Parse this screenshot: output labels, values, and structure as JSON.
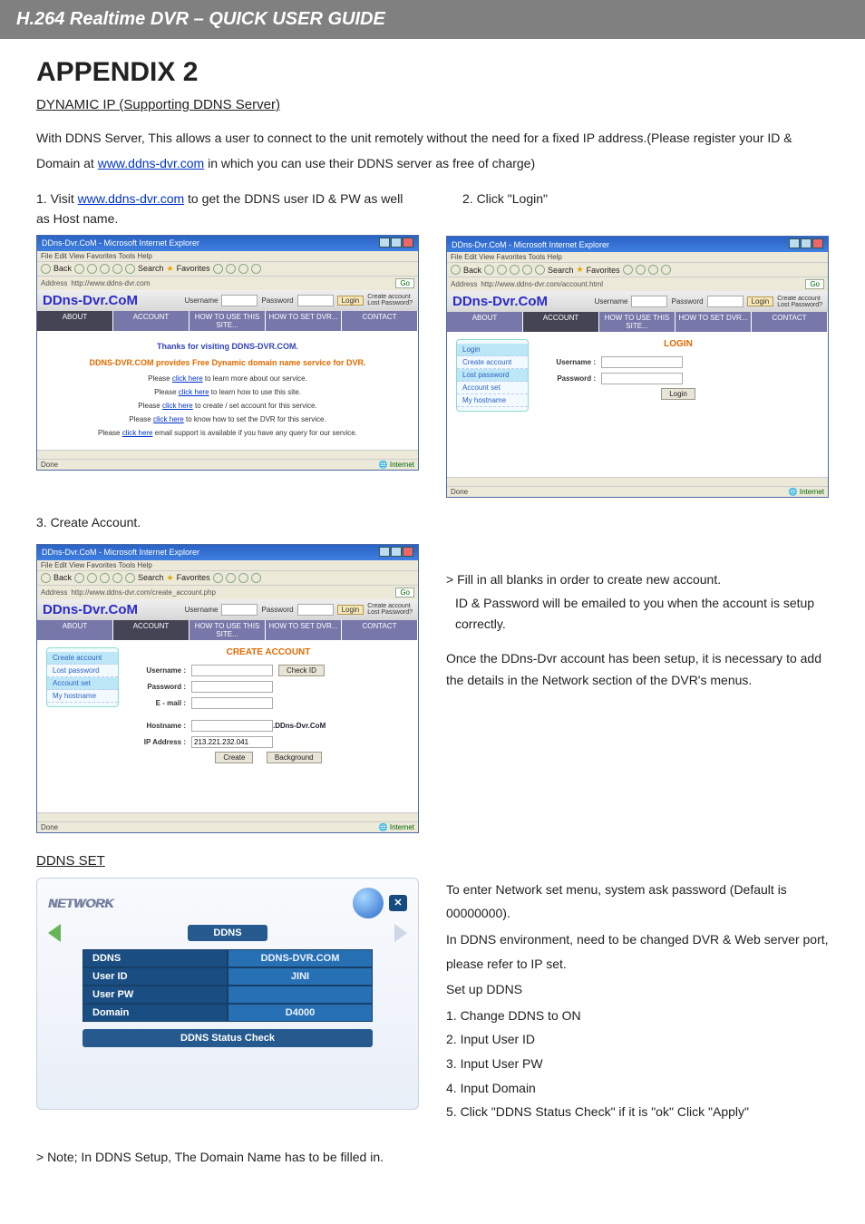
{
  "header_bar": "H.264 Realtime DVR – QUICK USER GUIDE",
  "appendix_title": "APPENDIX 2",
  "subheading": "DYNAMIC IP (Supporting DDNS Server)",
  "intro_a": "With DDNS Server, This allows a user to connect to the unit remotely without the need for a fixed IP address.(Please register your ID & Domain at ",
  "intro_link": "www.ddns-dvr.com",
  "intro_b": " in which you can use their DDNS server as free of charge)",
  "step1_num": "1.",
  "step1_a": "Visit ",
  "step1_link": "www.ddns-dvr.com",
  "step1_b": " to get the DDNS user ID & PW as well as Host name.",
  "step2": "2. Click \"Login\"",
  "step3": "3. Create Account.",
  "fill_line1": "> Fill in all blanks in order to create new account.",
  "fill_line2": "ID & Password will be emailed to you when the account is setup correctly.",
  "fill_line3": "Once the DDns-Dvr account has been setup, it is necessary to add the details in the Network section of the DVR's menus.",
  "ddns_set_heading": "DDNS SET",
  "ie_title": "DDns-Dvr.CoM - Microsoft Internet Explorer",
  "ie_menu": "File  Edit  View  Favorites  Tools  Help",
  "ie_back": "Back",
  "ie_search": "Search",
  "ie_fav": "Favorites",
  "addr_label": "Address",
  "addr1": "http://www.ddns-dvr.com",
  "addr2": "http://www.ddns-dvr.com/account.html",
  "addr3": "http://www.ddns-dvr.com/create_account.php",
  "go_btn": "Go",
  "brand": "DDns-Dvr.CoM",
  "login": {
    "user_lbl": "Username",
    "pass_lbl": "Password",
    "btn": "Login",
    "create": "Create account",
    "lost": "Lost Password?"
  },
  "nav": {
    "about": "ABOUT",
    "account": "ACCOUNT",
    "howuse": "HOW TO USE THIS SITE...",
    "howset": "HOW TO SET DVR...",
    "contact": "CONTACT"
  },
  "home": {
    "thanks": "Thanks for visiting DDNS-DVR.COM.",
    "provides": "DDNS-DVR.COM provides Free Dynamic domain name service for DVR.",
    "l1a": "Please ",
    "l1b": "click here",
    "l1c": " to learn more about our service.",
    "l2a": "Please ",
    "l2b": "click here",
    "l2c": " to learn how to use this site.",
    "l3a": "Please ",
    "l3b": "click here",
    "l3c": " to create / set account for this service.",
    "l4a": "Please ",
    "l4b": "click here",
    "l4c": " to know how to set the DVR for this service.",
    "l5a": "Please ",
    "l5b": "click here",
    "l5c": " email support is available if you have any query for our service."
  },
  "side": {
    "login": "Login",
    "create": "Create account",
    "lost": "Lost password",
    "acct": "Account set",
    "host": "My hostname"
  },
  "login_page": {
    "title": "LOGIN",
    "user": "Username :",
    "pass": "Password :",
    "btn": "Login"
  },
  "create_page": {
    "title": "CREATE ACCOUNT",
    "user": "Username :",
    "check": "Check ID",
    "pass": "Password :",
    "email": "E - mail :",
    "host": "Hostname :",
    "host_suffix": ".DDns-Dvr.CoM",
    "ip": "IP Address :",
    "ip_val": "213.221.232.041",
    "create_btn": "Create",
    "back_btn": "Background"
  },
  "status": {
    "done": "Done",
    "net": "Internet"
  },
  "network": {
    "logo": "NETWORK",
    "tab": "DDNS",
    "rows": [
      {
        "k": "DDNS",
        "v": "DDNS-DVR.COM"
      },
      {
        "k": "User ID",
        "v": "JINI"
      },
      {
        "k": "User PW",
        "v": ""
      },
      {
        "k": "Domain",
        "v": "D4000"
      }
    ],
    "status_check": "DDNS Status Check"
  },
  "rhs": {
    "p1": "To enter Network set menu, system ask password (Default is 00000000).",
    "p2": "In DDNS environment, need to be changed DVR & Web server port, please refer to IP set.",
    "p3": "Set up DDNS",
    "s1": "1. Change DDNS to ON",
    "s2": "2.   Input User ID",
    "s3": "3.   Input User PW",
    "s4": "4.   Input Domain",
    "s5": "5.   Click \"DDNS Status Check\" if it is \"ok\" Click \"Apply\""
  },
  "note": "> Note; In DDNS Setup, The Domain Name has to be filled in."
}
